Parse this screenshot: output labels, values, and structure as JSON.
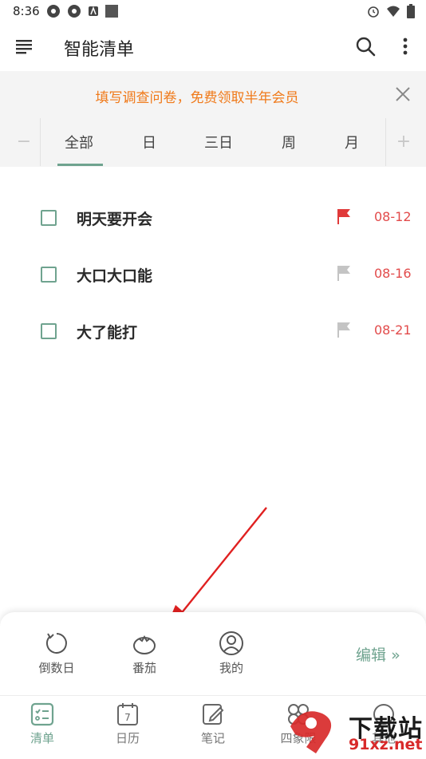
{
  "status_bar": {
    "time": "8:36"
  },
  "app_bar": {
    "title": "智能清单"
  },
  "banner": {
    "text": "填写调查问卷，免费领取半年会员"
  },
  "tabs": {
    "minus": "−",
    "plus": "+",
    "items": [
      "全部",
      "日",
      "三日",
      "周",
      "月"
    ]
  },
  "tasks": [
    {
      "title": "明天要开会",
      "date": "08-12",
      "flag": "red"
    },
    {
      "title": "大口大口能",
      "date": "08-16",
      "flag": "grey"
    },
    {
      "title": "大了能打",
      "date": "08-21",
      "flag": "grey"
    }
  ],
  "sheet": {
    "items": [
      {
        "label": "倒数日",
        "icon": "countdown-icon"
      },
      {
        "label": "番茄",
        "icon": "tomato-icon"
      },
      {
        "label": "我的",
        "icon": "profile-icon"
      }
    ],
    "edit_label": "编辑"
  },
  "nav": {
    "items": [
      {
        "label": "清单",
        "icon": "checklist-icon",
        "active": true
      },
      {
        "label": "日历",
        "icon": "calendar-icon",
        "calendar_day": "7"
      },
      {
        "label": "笔记",
        "icon": "note-icon"
      },
      {
        "label": "四象限",
        "icon": "quadrant-icon"
      },
      {
        "label": "其他",
        "icon": "other-icon"
      }
    ]
  },
  "watermark": {
    "top": "下载站",
    "bottom": "91xz.net"
  },
  "colors": {
    "accent": "#6fa38f",
    "banner_text": "#f07a1a",
    "date": "#e24b4b",
    "flag_red": "#e03a3a",
    "flag_grey": "#c4c4c4",
    "annotation_arrow": "#e02020"
  }
}
